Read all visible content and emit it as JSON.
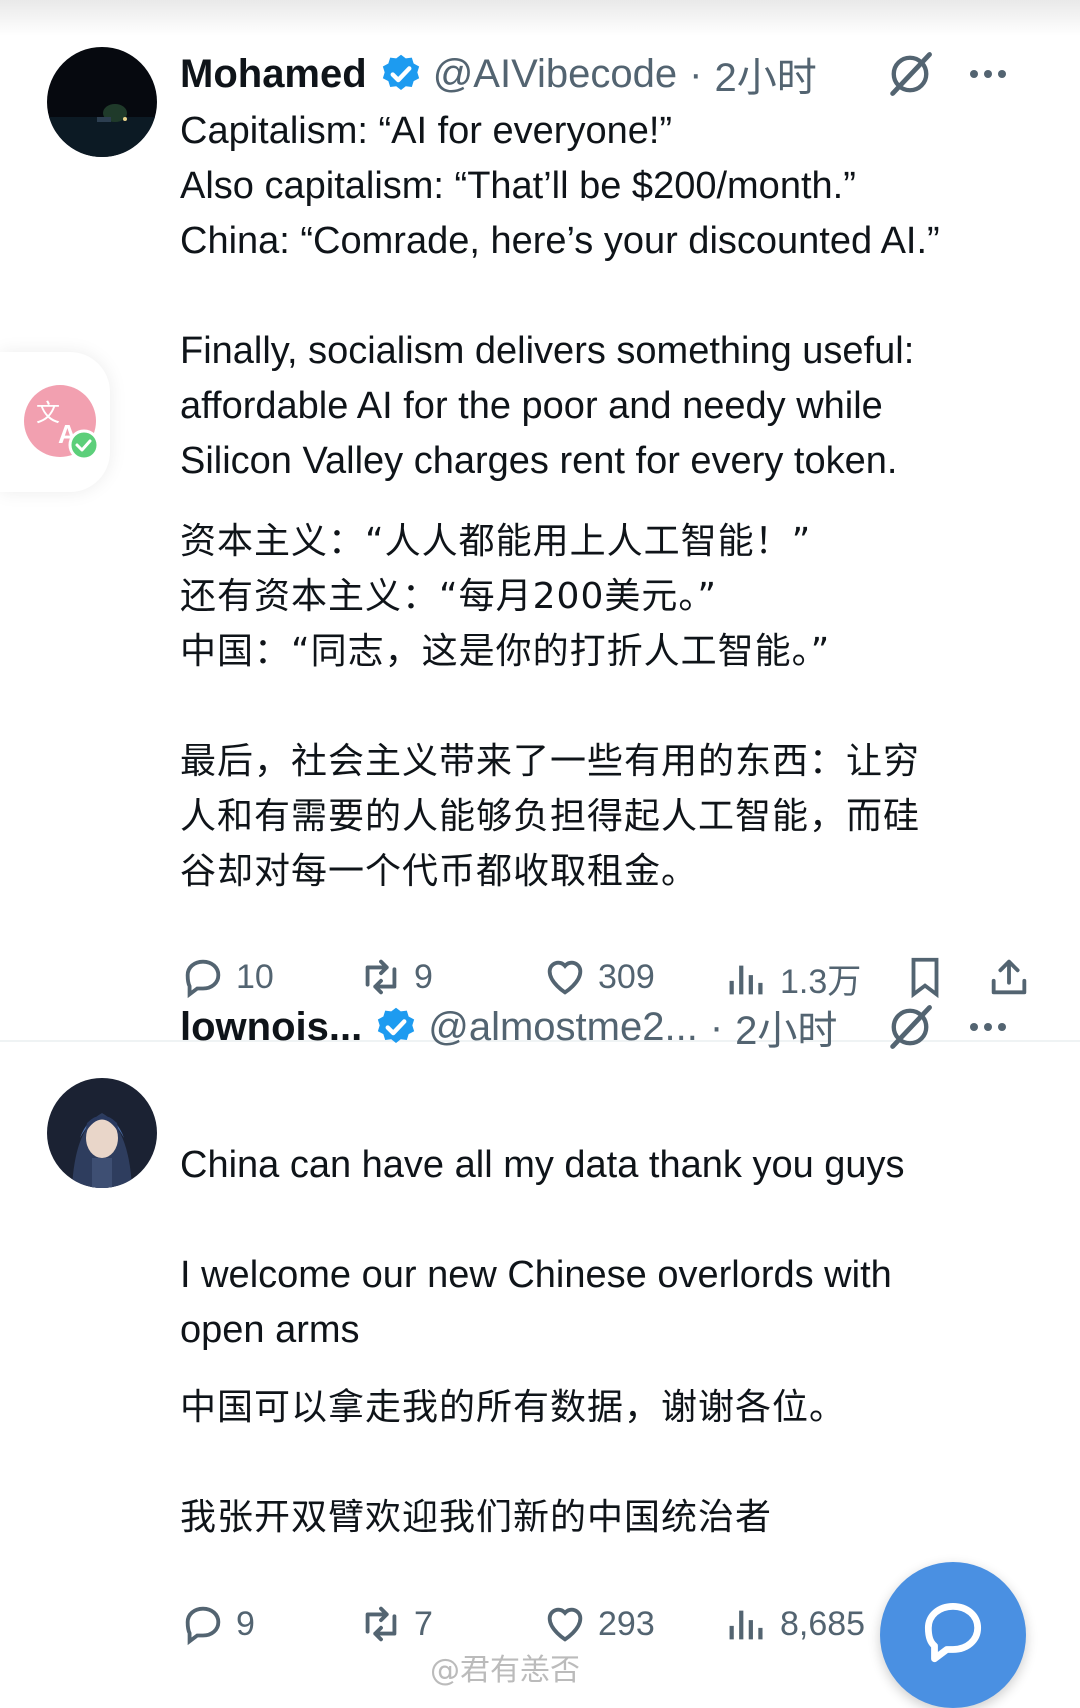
{
  "tweets": [
    {
      "author_name": "Mohamed",
      "handle": "@AIVibecode",
      "time": "2小时",
      "english_lines": [
        "Capitalism: “AI for everyone!”",
        "Also capitalism: “That’ll be $200/month.”",
        "China: “Comrade, here’s your discounted AI.”",
        "",
        "Finally, socialism delivers something useful:",
        "affordable AI for the poor and needy while",
        "Silicon Valley charges rent for every token."
      ],
      "chinese_lines": [
        "资本主义：“人人都能用上人工智能！”",
        "还有资本主义：“每月200美元。”",
        "中国：“同志，这是你的打折人工智能。”",
        "",
        "最后，社会主义带来了一些有用的东西：让穷",
        "人和有需要的人能够负担得起人工智能，而硅",
        "谷却对每一个代币都收取租金。"
      ],
      "replies": "10",
      "reposts": "9",
      "likes": "309",
      "views": "1.3万"
    },
    {
      "author_name": "lownois...",
      "handle": "@almostme2...",
      "time": "2小时",
      "english_lines": [
        "China can have all my data thank you guys",
        "",
        "I welcome our new Chinese overlords with",
        "open arms"
      ],
      "chinese_lines": [
        "中国可以拿走我的所有数据，谢谢各位。",
        "",
        "我张开双臂欢迎我们新的中国统治者"
      ],
      "replies": "9",
      "reposts": "7",
      "likes": "293",
      "views": "8,685"
    }
  ],
  "watermark": "@君有恙否",
  "colors": {
    "verified": "#1d9bf0",
    "secondary_text": "#536471",
    "fab": "#4a90e2"
  },
  "icons": {
    "header": [
      "verified-badge-icon",
      "grok-icon",
      "more-icon"
    ],
    "actions": [
      "reply-icon",
      "repost-icon",
      "like-icon",
      "views-icon",
      "bookmark-icon",
      "share-icon"
    ],
    "floating": [
      "translate-icon",
      "compose-message-icon"
    ]
  }
}
